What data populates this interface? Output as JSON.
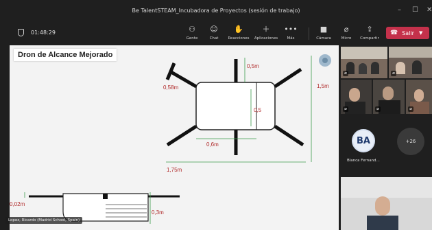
{
  "window": {
    "title": "Be TalentSTEAM_Incubadora de Proyectos (sesión de trabajo)",
    "controls": [
      "–",
      "☐",
      "✕"
    ]
  },
  "toolbar": {
    "timer": "01:48:29",
    "buttons": [
      {
        "label": "Gente",
        "icon": "people-icon",
        "glyph": "⚇"
      },
      {
        "label": "Chat",
        "icon": "chat-icon",
        "glyph": "☺"
      },
      {
        "label": "Reacciones",
        "icon": "reactions-icon",
        "glyph": "✋"
      },
      {
        "label": "Aplicaciones",
        "icon": "apps-icon",
        "glyph": "＋"
      },
      {
        "label": "Más",
        "icon": "more-icon",
        "glyph": "•••"
      },
      {
        "label": "Cámara",
        "icon": "camera-icon",
        "glyph": "■"
      },
      {
        "label": "Micro",
        "icon": "mic-off-icon",
        "glyph": "⌀"
      },
      {
        "label": "Compartir",
        "icon": "share-icon",
        "glyph": "⇪"
      }
    ],
    "leave_label": "Salir",
    "leave_color": "#c4314b"
  },
  "shared_screen": {
    "title": "Dron de Alcance Mejorado",
    "dimensions": {
      "d1": "0,5m",
      "d2": "0,58m",
      "d3": "1,5m",
      "d4": "0,5",
      "d5": "0,6m",
      "d6": "1,75m",
      "d7": "0,02m",
      "d8": "0,3m"
    },
    "speaker": "Lopez, Ricardo (Madrid School, Spain)"
  },
  "participants": {
    "avatar_initials": "BA",
    "avatar_name": "Blanca Fernand...",
    "more_count": "+26"
  }
}
